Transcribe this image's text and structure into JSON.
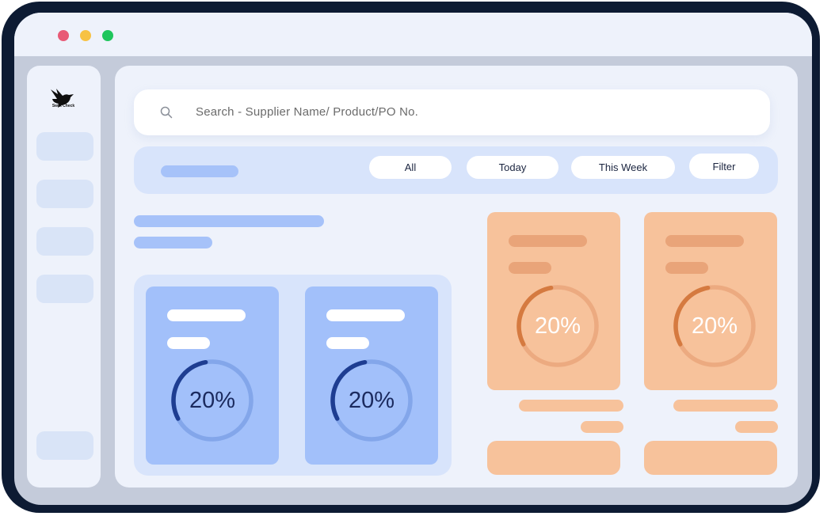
{
  "window": {
    "controls": [
      "close",
      "minimize",
      "maximize"
    ]
  },
  "sidebar": {
    "logo_text": "Swift Check"
  },
  "search": {
    "placeholder": "Search - Supplier Name/ Product/PO No."
  },
  "filters": {
    "chips": [
      "All",
      "Today",
      "This Week",
      "Filter"
    ]
  },
  "cards": [
    {
      "percent": 20,
      "percent_label": "20%",
      "theme": "blue"
    },
    {
      "percent": 20,
      "percent_label": "20%",
      "theme": "blue"
    },
    {
      "percent": 20,
      "percent_label": "20%",
      "theme": "orange"
    },
    {
      "percent": 20,
      "percent_label": "20%",
      "theme": "orange"
    }
  ],
  "colors": {
    "frame": "#0d1b33",
    "background": "#eef2fb",
    "blue_card": "#a2c0fa",
    "blue_gauge": "#1e3d91",
    "orange_card": "#f7c29b",
    "orange_gauge": "#d57a40",
    "dot_red": "#e85a76",
    "dot_yellow": "#f7c244",
    "dot_green": "#1fc65c"
  }
}
